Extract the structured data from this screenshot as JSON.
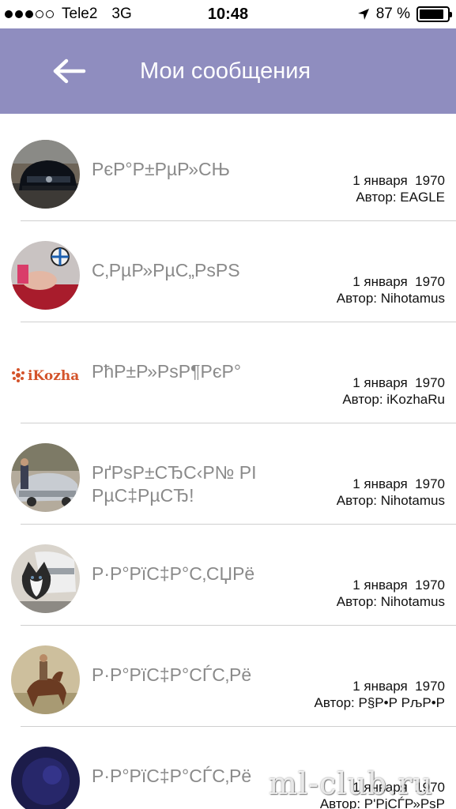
{
  "status_bar": {
    "carrier": "Tele2",
    "network": "3G",
    "time": "10:48",
    "battery": "87 %",
    "battery_level": 0.87,
    "signal_bars_filled": 3,
    "signal_bars_total": 5
  },
  "header": {
    "title": "Мои сообщения",
    "back_icon": "arrow-left-icon",
    "background": "#8f8dbf"
  },
  "messages": [
    {
      "title": "РєР°Р±РµР»СЊ",
      "date": "1 января  1970",
      "author": "Автор: EAGLE"
    },
    {
      "title": "С‚РµР»РµС„РѕРЅ",
      "date": "1 января  1970",
      "author": "Автор: Nihotamus"
    },
    {
      "title": "РћР±Р»РѕР¶РєР°",
      "date": "1 января  1970",
      "author": "Автор: iKozhaRu",
      "logo_text": "iKozha"
    },
    {
      "title": "РґРѕР±СЂС‹Р№ РІРµС‡РµСЂ!",
      "date": "1 января  1970",
      "author": "Автор: Nihotamus"
    },
    {
      "title": "Р·Р°РїС‡Р°С‚СЏРё",
      "date": "1 января  1970",
      "author": "Автор: Nihotamus"
    },
    {
      "title": "Р·Р°РїС‡Р°СЃС‚Рё",
      "date": "1 января  1970",
      "author": "Автор: Р§Р•Р РљР•Р"
    },
    {
      "title": "Р·Р°РїС‡Р°СЃС‚Рё",
      "date": "1 января  1970",
      "author": "Автор: Р'РјСЃР»РѕР"
    }
  ],
  "watermark": "ml-club.ru"
}
